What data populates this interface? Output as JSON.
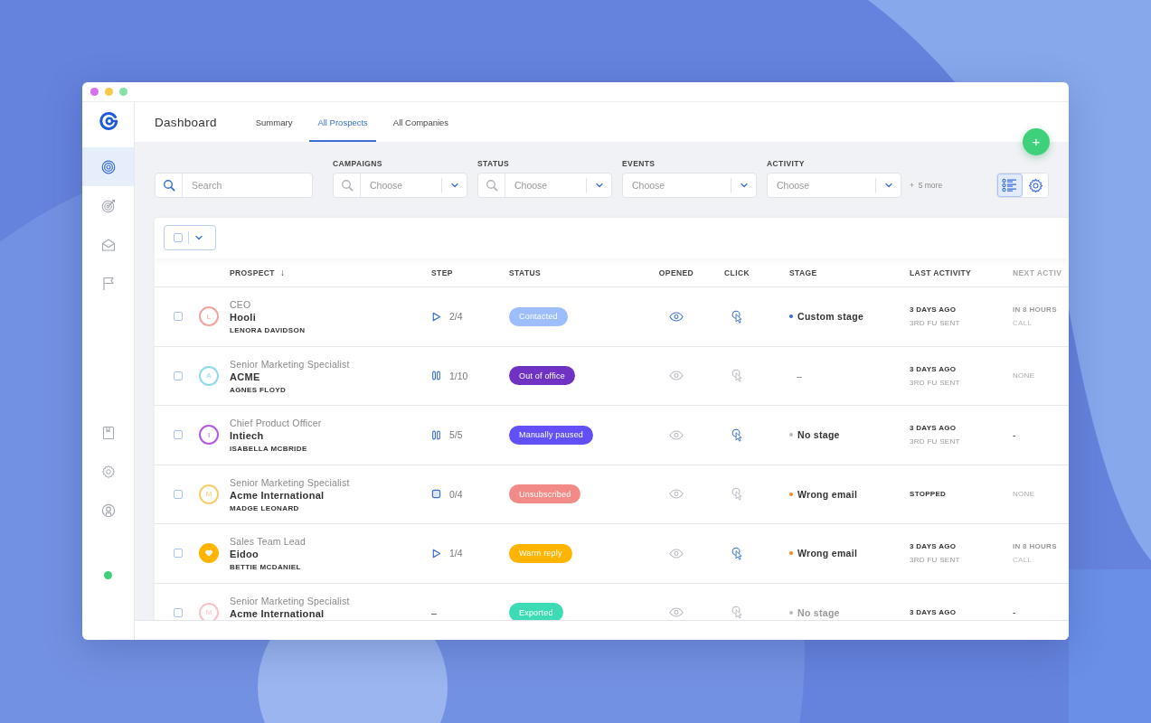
{
  "window": {
    "controls": [
      {
        "color": "#d86ff0"
      },
      {
        "color": "#f7c84a"
      },
      {
        "color": "#84e2a8"
      }
    ]
  },
  "sidebar": {
    "top_items": [
      {
        "selected": true
      },
      {
        "selected": false
      },
      {
        "selected": false
      },
      {
        "selected": false
      }
    ],
    "bottom_items": [
      {
        "selected": false
      },
      {
        "selected": false
      },
      {
        "selected": false
      }
    ],
    "presence": {
      "online": true
    }
  },
  "header": {
    "title": "Dashboard",
    "tabs": [
      {
        "label": "Summary",
        "selected": false
      },
      {
        "label": "All Prospects",
        "selected": true
      },
      {
        "label": "All Companies",
        "selected": false
      }
    ]
  },
  "add_button": {
    "label": "+"
  },
  "filters": {
    "search": {
      "placeholder": "Search"
    },
    "dropdowns": [
      {
        "label": "CAMPAIGNS",
        "placeholder": "Choose",
        "search_icon": true
      },
      {
        "label": "STATUS",
        "placeholder": "Choose",
        "search_icon": true
      },
      {
        "label": "EVENTS",
        "placeholder": "Choose",
        "search_icon": false
      },
      {
        "label": "ACTIVITY",
        "placeholder": "Choose",
        "search_icon": false
      }
    ],
    "more": "+  5 more"
  },
  "view_toggle": [
    {
      "kind": "list",
      "selected": true
    },
    {
      "kind": "settings",
      "selected": false
    }
  ],
  "bulk_select": {
    "checked": false
  },
  "table": {
    "columns": [
      {
        "label": "PROSPECT",
        "sort": "↓",
        "faded": false
      },
      {
        "label": "STEP",
        "faded": false
      },
      {
        "label": "STATUS",
        "faded": false
      },
      {
        "label": "OPENED",
        "faded": false
      },
      {
        "label": "CLICK",
        "faded": false
      },
      {
        "label": "STAGE",
        "faded": false
      },
      {
        "label": "LAST ACTIVITY",
        "faded": false
      },
      {
        "label": "NEXT ACTIV",
        "faded": true
      }
    ],
    "rows": [
      {
        "checked": false,
        "avatar": {
          "kind": "letter",
          "letter": "L",
          "color": "#f2a3a0"
        },
        "title": "CEO",
        "company": "Hooli",
        "name": "LENORA DAVIDSON",
        "step": {
          "kind": "play",
          "text": "2/4"
        },
        "status": {
          "label": "Contacted",
          "color": "#9dbdfb"
        },
        "opened": true,
        "clicked": true,
        "stage": {
          "label": "Custom stage",
          "color": "#2d6ad8",
          "muted": false
        },
        "last_activity": {
          "primary": "3 DAYS AGO",
          "secondary": "3RD FU SENT"
        },
        "next_activity": {
          "kind": "scheduled",
          "primary": "IN 8 HOURS",
          "secondary": "CALL"
        }
      },
      {
        "checked": false,
        "avatar": {
          "kind": "letter",
          "letter": "A",
          "color": "#8fd9f0"
        },
        "title": "Senior Marketing Specialist",
        "company": "ACME",
        "name": "AGNES FLOYD",
        "step": {
          "kind": "pause",
          "text": "1/10"
        },
        "status": {
          "label": "Out of office",
          "color": "#7032c3"
        },
        "opened": false,
        "clicked": false,
        "stage": {
          "label": "–",
          "muted": false
        },
        "last_activity": {
          "primary": "3 DAYS AGO",
          "secondary": "3RD FU SENT"
        },
        "next_activity": {
          "kind": "none",
          "primary": "NONE"
        }
      },
      {
        "checked": false,
        "avatar": {
          "kind": "letter",
          "letter": "I",
          "color": "#b659e0"
        },
        "title": "Chief Product Officer",
        "company": "Intiech",
        "name": "ISABELLA MCBRIDE",
        "step": {
          "kind": "pause",
          "text": "5/5"
        },
        "status": {
          "label": "Manually paused",
          "color": "#6150f5"
        },
        "opened": false,
        "clicked": true,
        "stage": {
          "label": "No stage",
          "color": "#bbbbbb",
          "muted": false
        },
        "last_activity": {
          "primary": "3 DAYS AGO",
          "secondary": "3RD FU SENT"
        },
        "next_activity": {
          "kind": "empty",
          "primary": "-"
        }
      },
      {
        "checked": false,
        "avatar": {
          "kind": "letter",
          "letter": "M",
          "color": "#f7cd6b"
        },
        "title": "Senior Marketing Specialist",
        "company": "Acme International",
        "name": "MADGE LEONARD",
        "step": {
          "kind": "stop",
          "text": "0/4"
        },
        "status": {
          "label": "Unsubscribed",
          "color": "#f28b88"
        },
        "opened": false,
        "clicked": false,
        "stage": {
          "label": "Wrong email",
          "color": "#f28a1e",
          "muted": false
        },
        "last_activity": {
          "primary": "STOPPED"
        },
        "next_activity": {
          "kind": "none",
          "primary": "NONE"
        }
      },
      {
        "checked": false,
        "avatar": {
          "kind": "heart",
          "color": "#ffb400"
        },
        "title": "Sales Team Lead",
        "company": "Eidoo",
        "name": "BETTIE MCDANIEL",
        "step": {
          "kind": "play",
          "text": "1/4"
        },
        "status": {
          "label": "Warm reply",
          "color": "#ffb400"
        },
        "opened": false,
        "clicked": true,
        "stage": {
          "label": "Wrong email",
          "color": "#f28a1e",
          "muted": false
        },
        "last_activity": {
          "primary": "3 DAYS AGO",
          "secondary": "3RD FU SENT"
        },
        "next_activity": {
          "kind": "scheduled",
          "primary": "IN 8 HOURS",
          "secondary": "CALL"
        }
      },
      {
        "checked": false,
        "avatar": {
          "kind": "letter",
          "letter": "M",
          "color": "#f7c3cb"
        },
        "title": "Senior Marketing Specialist",
        "company": "Acme International",
        "step": {
          "kind": "none",
          "text": "–"
        },
        "status": {
          "label": "Exported",
          "color": "#3ddbb4"
        },
        "opened": false,
        "clicked": false,
        "stage": {
          "label": "No stage",
          "color": "#bbbbbb",
          "muted": true
        },
        "last_activity": {
          "primary": "3 DAYS AGO"
        },
        "next_activity": {
          "kind": "empty",
          "primary": "-"
        }
      }
    ]
  }
}
